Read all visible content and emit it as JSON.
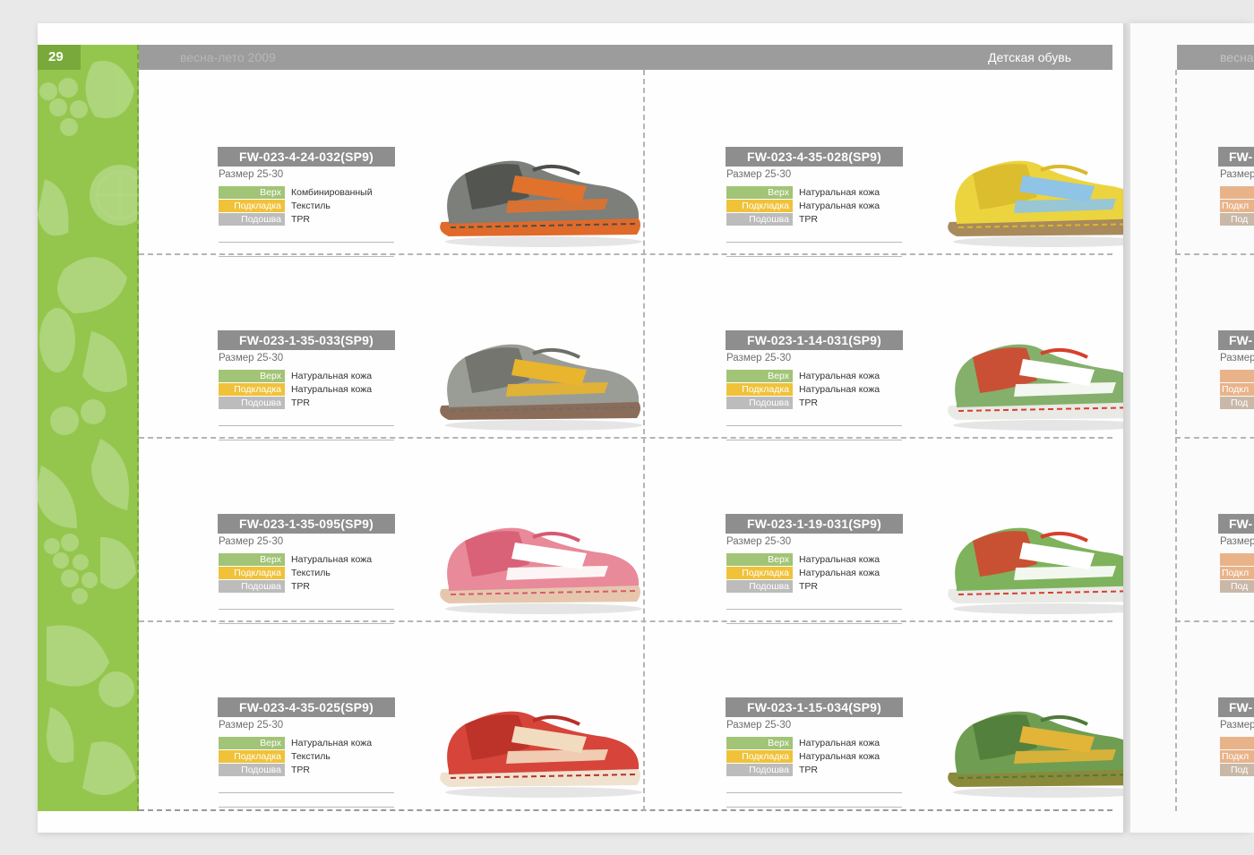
{
  "page": {
    "number": "29",
    "season": "весна-лето 2009",
    "section": "Детская обувь",
    "next_page_season": "весна"
  },
  "spec_labels": {
    "upper": "Верх",
    "lining": "Подкладка",
    "sole": "Подошва"
  },
  "products": [
    {
      "code": "FW-023-4-24-032(SP9)",
      "size": "Размер 25-30",
      "upper": "Комбинированный",
      "lining": "Текстиль",
      "sole": "TPR",
      "colors": {
        "body": "#7c7f7a",
        "accent": "#e0722c",
        "sole": "#e06a2a",
        "trim": "#4c4e4a"
      }
    },
    {
      "code": "FW-023-4-35-028(SP9)",
      "size": "Размер 25-30",
      "upper": "Натуральная кожа",
      "lining": "Натуральная кожа",
      "sole": "TPR",
      "colors": {
        "body": "#ecd43e",
        "accent": "#8fc4e6",
        "sole": "#a98a5c",
        "trim": "#d9b92a"
      }
    },
    {
      "code": "FW-023-1-35-033(SP9)",
      "size": "Размер 25-30",
      "upper": "Натуральная кожа",
      "lining": "Натуральная кожа",
      "sole": "TPR",
      "colors": {
        "body": "#9a9c96",
        "accent": "#e8b52c",
        "sole": "#8a6c58",
        "trim": "#6d6f69"
      }
    },
    {
      "code": "FW-023-1-14-031(SP9)",
      "size": "Размер 25-30",
      "upper": "Натуральная кожа",
      "lining": "Натуральная кожа",
      "sole": "TPR",
      "colors": {
        "body": "#84b06c",
        "accent": "#ffffff",
        "sole": "#e9e9e6",
        "trim": "#d6402c"
      }
    },
    {
      "code": "FW-023-1-35-095(SP9)",
      "size": "Размер 25-30",
      "upper": "Натуральная кожа",
      "lining": "Текстиль",
      "sole": "TPR",
      "colors": {
        "body": "#e88a9a",
        "accent": "#ffffff",
        "sole": "#e6c7ad",
        "trim": "#d65a72"
      }
    },
    {
      "code": "FW-023-1-19-031(SP9)",
      "size": "Размер 25-30",
      "upper": "Натуральная кожа",
      "lining": "Натуральная кожа",
      "sole": "TPR",
      "colors": {
        "body": "#7fb25c",
        "accent": "#ffffff",
        "sole": "#e9e9e6",
        "trim": "#d6402c"
      }
    },
    {
      "code": "FW-023-4-35-025(SP9)",
      "size": "Размер 25-30",
      "upper": "Натуральная кожа",
      "lining": "Текстиль",
      "sole": "TPR",
      "colors": {
        "body": "#d6443a",
        "accent": "#f2dcc0",
        "sole": "#efe2cf",
        "trim": "#b83028"
      }
    },
    {
      "code": "FW-023-1-15-034(SP9)",
      "size": "Размер 25-30",
      "upper": "Натуральная кожа",
      "lining": "Натуральная кожа",
      "sole": "TPR",
      "colors": {
        "body": "#6f9e52",
        "accent": "#e2b437",
        "sole": "#8a8a3a",
        "trim": "#4f7a3a"
      }
    }
  ],
  "next_page_rows": [
    {
      "code_fragment": "FW-",
      "size_fragment": "Размер",
      "lining_fragment": "Подкл",
      "sole_fragment": "Под"
    },
    {
      "code_fragment": "FW-",
      "size_fragment": "Размер",
      "lining_fragment": "Подкл",
      "sole_fragment": "Под"
    },
    {
      "code_fragment": "FW-",
      "size_fragment": "Размер",
      "lining_fragment": "Подкл",
      "sole_fragment": "Под"
    },
    {
      "code_fragment": "FW-",
      "size_fragment": "Размер",
      "lining_fragment": "Подкл",
      "sole_fragment": "Под"
    }
  ],
  "theme": {
    "sidebar_green": "#94c64e",
    "header_gray": "#9c9c9c",
    "tag_gray": "#8e8e8e"
  }
}
